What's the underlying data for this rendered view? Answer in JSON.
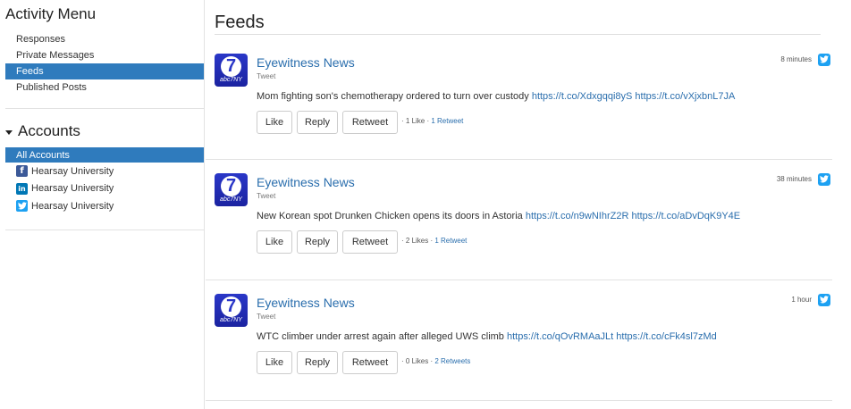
{
  "sidebar": {
    "menu_title": "Activity Menu",
    "menu_items": [
      {
        "label": "Responses",
        "active": false
      },
      {
        "label": "Private Messages",
        "active": false
      },
      {
        "label": "Feeds",
        "active": true
      },
      {
        "label": "Published Posts",
        "active": false
      }
    ],
    "accounts_title": "Accounts",
    "all_accounts_label": "All Accounts",
    "accounts": [
      {
        "network": "facebook",
        "icon": "facebook-icon",
        "name": "Hearsay University"
      },
      {
        "network": "linkedin",
        "icon": "linkedin-icon",
        "name": "Hearsay University"
      },
      {
        "network": "twitter",
        "icon": "twitter-icon",
        "name": "Hearsay University"
      }
    ]
  },
  "main": {
    "title": "Feeds",
    "posts": [
      {
        "author": "Eyewitness News",
        "type": "Tweet",
        "time": "8 minutes",
        "text": "Mom fighting son's chemotherapy ordered to turn over custody",
        "link1": "https://t.co/Xdxgqqi8yS",
        "link2": "https://t.co/vXjxbnL7JA",
        "likes": "1 Like",
        "retweets": "1 Retweet"
      },
      {
        "author": "Eyewitness News",
        "type": "Tweet",
        "time": "38 minutes",
        "text": "New Korean spot Drunken Chicken opens its doors in Astoria",
        "link1": "https://t.co/n9wNIhrZ2R",
        "link2": "https://t.co/aDvDqK9Y4E",
        "likes": "2 Likes",
        "retweets": "1 Retweet"
      },
      {
        "author": "Eyewitness News",
        "type": "Tweet",
        "time": "1 hour",
        "text": "WTC climber under arrest again after alleged UWS climb",
        "link1": "https://t.co/qOvRMAaJLt",
        "link2": "https://t.co/cFk4sl7zMd",
        "likes": "0 Likes",
        "retweets": "2 Retweets"
      }
    ],
    "buttons": {
      "like": "Like",
      "reply": "Reply",
      "retweet": "Retweet"
    },
    "avatar": {
      "number": "7",
      "brand": "abc7NY"
    }
  },
  "colors": {
    "accent": "#2f7bbd",
    "link": "#2a6ead",
    "twitter": "#1da1f2",
    "facebook": "#3b5998",
    "linkedin": "#0077b5",
    "avatar": "#2a37c8"
  }
}
